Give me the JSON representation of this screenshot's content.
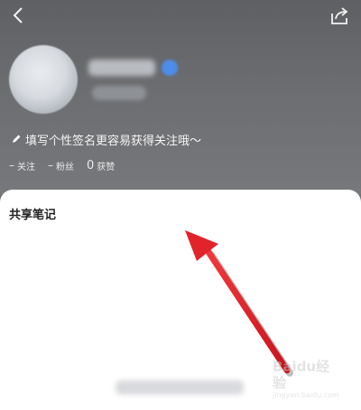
{
  "profile": {
    "bio": "填写个性签名更容易获得关注哦～",
    "stats": [
      {
        "count": "–",
        "label": "关注"
      },
      {
        "count": "–",
        "label": "粉丝"
      },
      {
        "count": "0",
        "label": "获赞"
      }
    ]
  },
  "sheet": {
    "title": "共享笔记"
  },
  "watermark": {
    "brand": "Baidu经验",
    "url": "jingyan.baidu.com"
  },
  "icons": [
    "back-icon",
    "share-icon",
    "verified-icon",
    "pencil-icon"
  ],
  "colors": {
    "header_bg": "#6f7073",
    "sheet_bg": "#ffffff",
    "arrow_red": "#e0242a",
    "verified_blue": "#4d8ce8"
  }
}
